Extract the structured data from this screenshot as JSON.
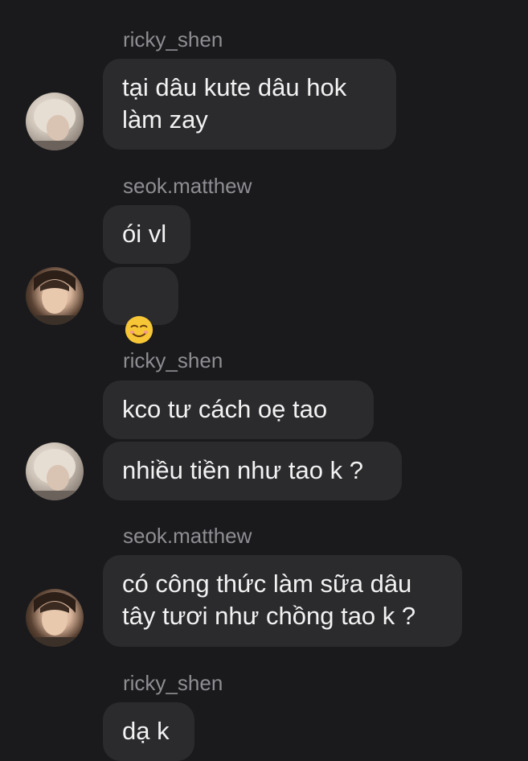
{
  "messages": [
    {
      "sender": "ricky_shen",
      "bubbles": [
        "tại dâu kute dâu hok\nlàm zay"
      ]
    },
    {
      "sender": "seok.matthew",
      "bubbles": [
        "ói vl",
        "☺️"
      ]
    },
    {
      "sender": "ricky_shen",
      "bubbles": [
        "kco tư cách oẹ tao",
        "nhiều tiền như tao k ?"
      ]
    },
    {
      "sender": "seok.matthew",
      "bubbles": [
        "có công thức làm sữa dâu\ntây tươi như chồng tao k ?"
      ]
    },
    {
      "sender": "ricky_shen",
      "bubbles": [
        "dạ k"
      ]
    }
  ],
  "colors": {
    "background": "#1a1a1c",
    "bubble": "#2b2b2e",
    "sender_text": "#8e8e93",
    "message_text": "#f2f2f2"
  },
  "icons": {
    "ricky_avatar": "user-avatar-light-hair",
    "seok_avatar": "user-avatar-dark-hair",
    "emoji": "smiling-face-emoji"
  }
}
